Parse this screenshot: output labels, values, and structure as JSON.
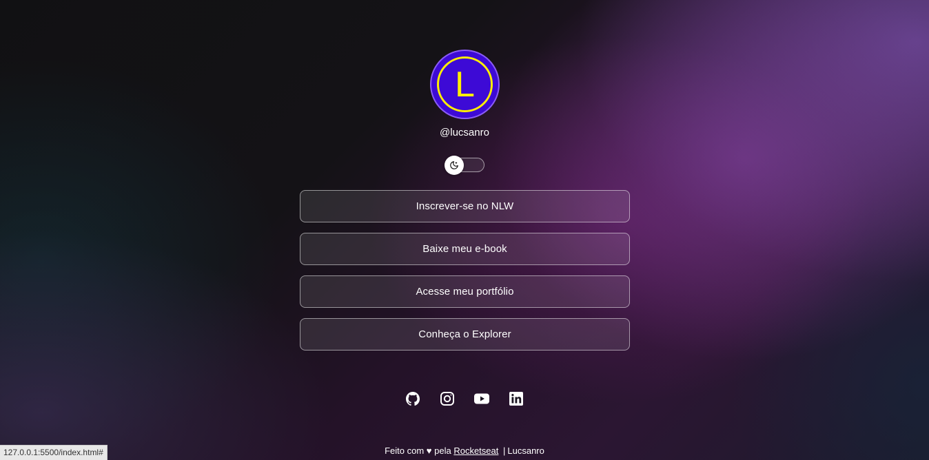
{
  "profile": {
    "avatar_letter": "L",
    "handle": "@lucsanro"
  },
  "theme_switch": {
    "icon": "moon-icon",
    "state": "dark"
  },
  "links": [
    {
      "label": "Inscrever-se no NLW"
    },
    {
      "label": "Baixe meu e-book"
    },
    {
      "label": "Acesse meu portfólio"
    },
    {
      "label": "Conheça o Explorer"
    }
  ],
  "social": [
    {
      "icon": "github-icon"
    },
    {
      "icon": "instagram-icon"
    },
    {
      "icon": "youtube-icon"
    },
    {
      "icon": "linkedin-icon"
    }
  ],
  "footer": {
    "prefix": "Feito com ♥ pela",
    "brand_link": "Rocketseat",
    "separator": "|",
    "author": "Lucsanro"
  },
  "status_bar": {
    "url": "127.0.0.1:5500/index.html#"
  },
  "colors": {
    "avatar_bg": "#3d0ad6",
    "avatar_ring": "#ffef00",
    "avatar_border": "#8a5cf6"
  }
}
